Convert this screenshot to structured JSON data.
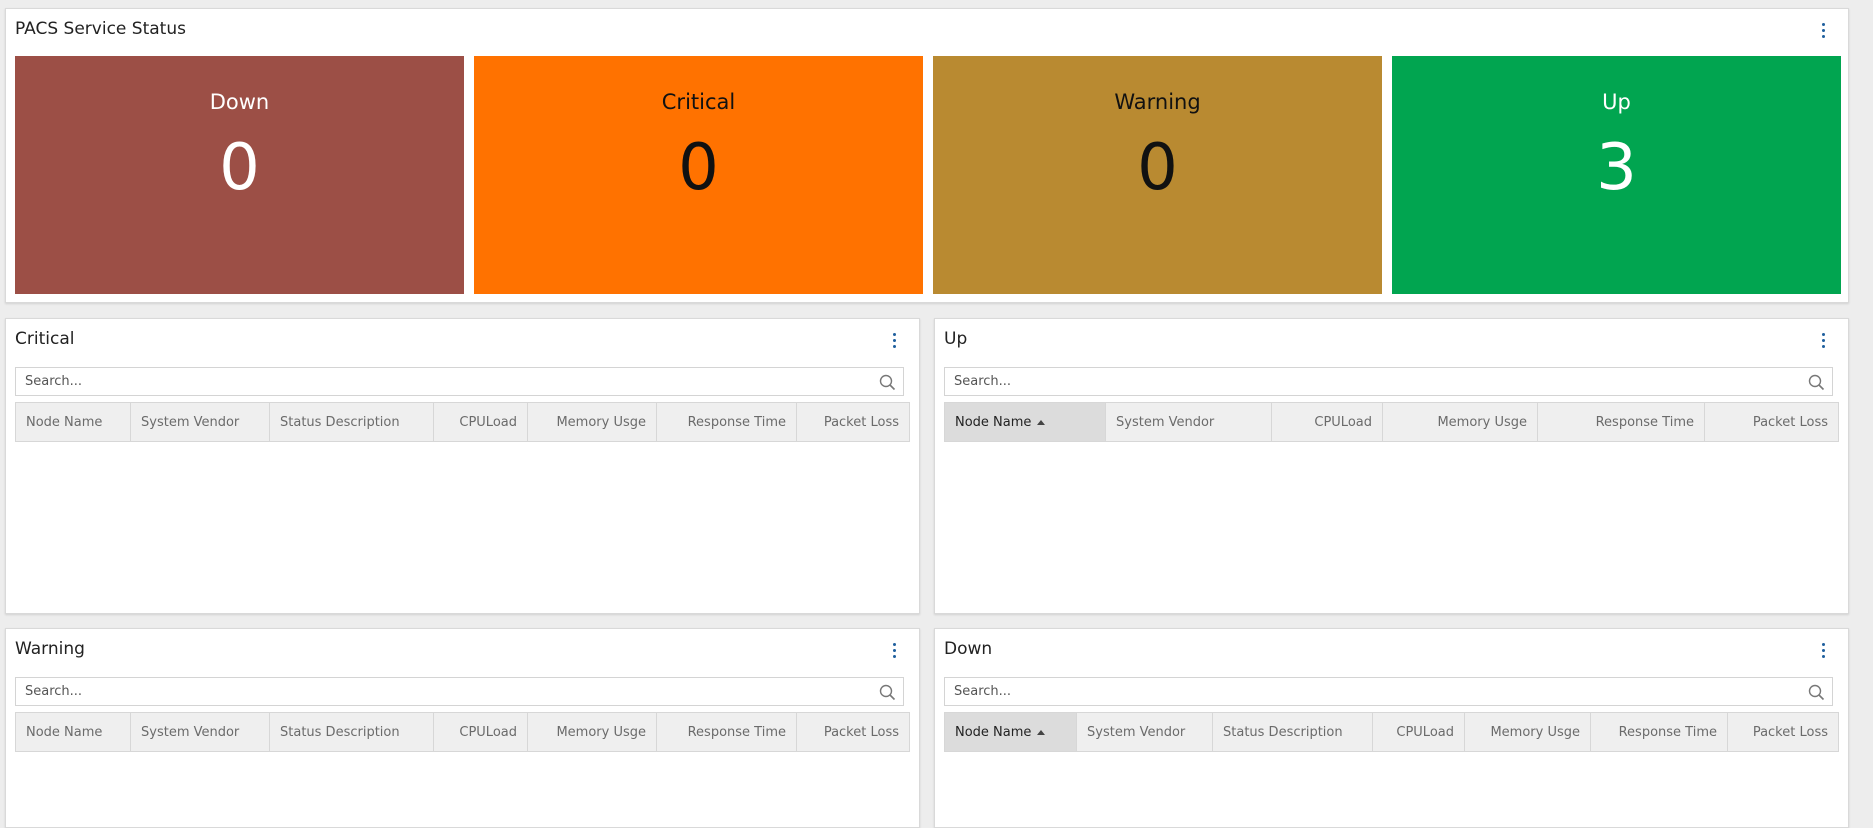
{
  "status_panel": {
    "title": "PACS Service Status",
    "tiles": [
      {
        "label": "Down",
        "value": "0",
        "color": "#9c4f46"
      },
      {
        "label": "Critical",
        "value": "0",
        "color": "#ff7200"
      },
      {
        "label": "Warning",
        "value": "0",
        "color": "#b98a31"
      },
      {
        "label": "Up",
        "value": "3",
        "color": "#01a550"
      }
    ]
  },
  "critical_panel": {
    "title": "Critical",
    "search_placeholder": "Search...",
    "columns": [
      "Node Name",
      "System Vendor",
      "Status Description",
      "CPULoad",
      "Memory Usge",
      "Response Time",
      "Packet Loss"
    ]
  },
  "up_panel": {
    "title": "Up",
    "search_placeholder": "Search...",
    "columns": [
      "Node Name",
      "System Vendor",
      "CPULoad",
      "Memory Usge",
      "Response Time",
      "Packet Loss"
    ]
  },
  "warning_panel": {
    "title": "Warning",
    "search_placeholder": "Search...",
    "columns": [
      "Node Name",
      "System Vendor",
      "Status Description",
      "CPULoad",
      "Memory Usge",
      "Response Time",
      "Packet Loss"
    ]
  },
  "down_panel": {
    "title": "Down",
    "search_placeholder": "Search...",
    "columns": [
      "Node Name",
      "System Vendor",
      "Status Description",
      "CPULoad",
      "Memory Usge",
      "Response Time",
      "Packet Loss"
    ]
  },
  "colors": {
    "accent": "#1f5f9e",
    "tile_text_light": "#ffffff",
    "tile_text_dark": "#111111"
  },
  "icons": [
    "more-vertical-icon",
    "search-icon",
    "sort-ascending-icon"
  ]
}
